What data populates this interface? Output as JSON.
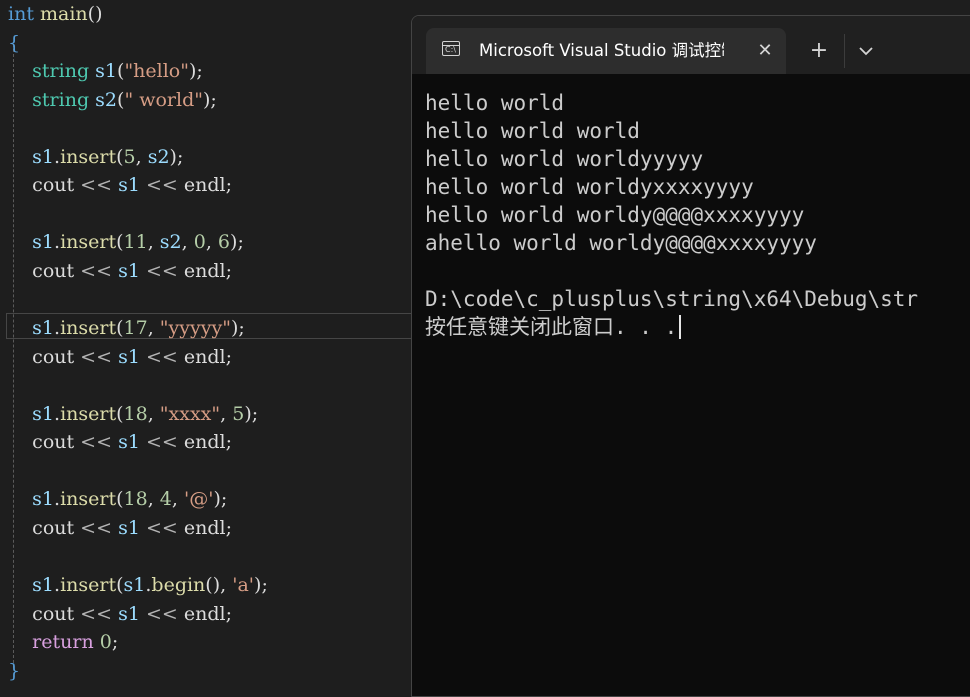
{
  "editor": {
    "lines": [
      "int main()",
      "{",
      "    string s1(\"hello\");",
      "    string s2(\" world\");",
      "",
      "    s1.insert(5, s2);",
      "    cout << s1 << endl;",
      "",
      "    s1.insert(11, s2, 0, 6);",
      "    cout << s1 << endl;",
      "",
      "    s1.insert(17, \"yyyyy\");",
      "    cout << s1 << endl;",
      "",
      "    s1.insert(18, \"xxxx\", 5);",
      "    cout << s1 << endl;",
      "",
      "    s1.insert(18, 4, '@');",
      "    cout << s1 << endl;",
      "",
      "    s1.insert(s1.begin(), 'a');",
      "    cout << s1 << endl;",
      "    return 0;",
      "}"
    ]
  },
  "console": {
    "tab_title": "Microsoft Visual Studio 调试控制台",
    "tab_icon_text": "C:\\",
    "close_label": "✕",
    "new_tab_label": "+",
    "output_lines": [
      "hello world",
      "hello world world",
      "hello world worldyyyyy",
      "hello world worldyxxxxyyyy",
      "hello world worldy@@@@xxxxyyyy",
      "ahello world worldy@@@@xxxxyyyy",
      "",
      "D:\\code\\c_plusplus\\string\\x64\\Debug\\str",
      "按任意键关闭此窗口. . ."
    ]
  },
  "colors": {
    "editor_bg": "#1e1e1e",
    "console_bg": "#0c0c0c",
    "titlebar_bg": "#202020",
    "tab_bg": "#2d2d2d",
    "keyword": "#569cd6",
    "type": "#4ec9b0",
    "function": "#dcdcaa",
    "variable": "#9cdcfe",
    "string": "#d69d85",
    "number": "#b5cea8"
  },
  "icons": [
    "console-app-icon",
    "close-icon",
    "plus-icon",
    "chevron-down-icon"
  ]
}
